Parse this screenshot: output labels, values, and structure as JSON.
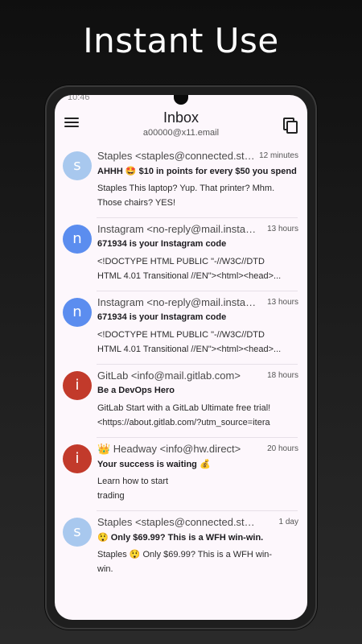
{
  "headline": "Instant Use",
  "status_time": "10:46",
  "header": {
    "title": "Inbox",
    "account": "a00000@x11.email"
  },
  "colors": {
    "avatar_light_blue": "#a8c8ee",
    "avatar_blue": "#5b8def",
    "avatar_red": "#c23a2b"
  },
  "emails": [
    {
      "avatar_letter": "s",
      "avatar_color": "#a8c8ee",
      "sender": "Staples <staples@connected.staples.com>",
      "time": "12 minutes",
      "subject": "AHHH 🤩 $10 in points for every $50 you spend",
      "preview": "Staples This laptop? Yup. That printer? Mhm.\nThose chairs? YES!"
    },
    {
      "avatar_letter": "n",
      "avatar_color": "#5b8def",
      "sender": "Instagram <no-reply@mail.instagram.com>",
      "time": "13 hours",
      "subject": "671934 is your Instagram code",
      "preview": "<!DOCTYPE HTML PUBLIC \"-//W3C//DTD\nHTML 4.01 Transitional //EN\"><html><head>..."
    },
    {
      "avatar_letter": "n",
      "avatar_color": "#5b8def",
      "sender": "Instagram <no-reply@mail.instagram.com>",
      "time": "13 hours",
      "subject": "671934 is your Instagram code",
      "preview": "<!DOCTYPE HTML PUBLIC \"-//W3C//DTD\nHTML 4.01 Transitional //EN\"><html><head>..."
    },
    {
      "avatar_letter": "i",
      "avatar_color": "#c23a2b",
      "sender": "GitLab <info@mail.gitlab.com>",
      "time": "18 hours",
      "subject": "Be a DevOps Hero",
      "preview": "GitLab Start with a GitLab Ultimate free trial!\n<https://about.gitlab.com/?utm_source=itera"
    },
    {
      "avatar_letter": "i",
      "avatar_color": "#c23a2b",
      "sender": "👑 Headway <info@hw.direct>",
      "time": "20 hours",
      "subject": "Your success is waiting 💰",
      "preview": "Learn how to start\ntrading"
    },
    {
      "avatar_letter": "s",
      "avatar_color": "#a8c8ee",
      "sender": "Staples <staples@connected.staples.com>",
      "time": "1 day",
      "subject": "😲 Only $69.99? This is a WFH win-win.",
      "preview": "Staples 😲 Only $69.99? This is a WFH win-\nwin."
    }
  ]
}
